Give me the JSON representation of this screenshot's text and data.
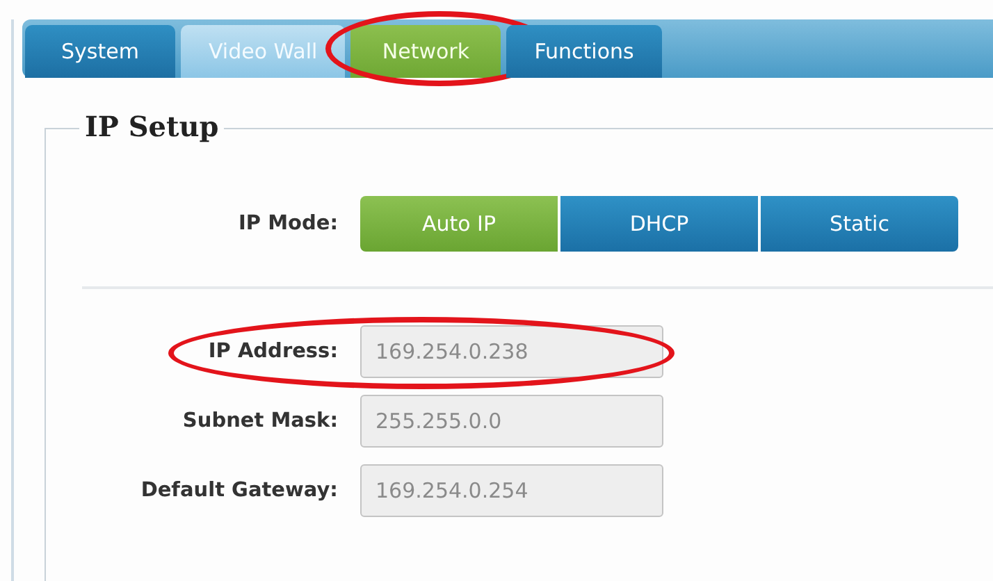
{
  "tabs": [
    {
      "label": "System",
      "selected": false,
      "highlighted": false,
      "circled": false
    },
    {
      "label": "Video Wall",
      "selected": false,
      "highlighted": true,
      "circled": false
    },
    {
      "label": "Network",
      "selected": true,
      "highlighted": false,
      "circled": true
    },
    {
      "label": "Functions",
      "selected": false,
      "highlighted": false,
      "circled": false
    }
  ],
  "section": {
    "title": "IP Setup"
  },
  "ip_mode": {
    "label": "IP Mode:",
    "options": [
      {
        "label": "Auto IP",
        "selected": true
      },
      {
        "label": "DHCP",
        "selected": false
      },
      {
        "label": "Static",
        "selected": false
      }
    ]
  },
  "fields": [
    {
      "label": "IP Address:",
      "value": "169.254.0.238",
      "circled": true
    },
    {
      "label": "Subnet Mask:",
      "value": "255.255.0.0",
      "circled": false
    },
    {
      "label": "Default Gateway:",
      "value": "169.254.0.254",
      "circled": false
    }
  ]
}
